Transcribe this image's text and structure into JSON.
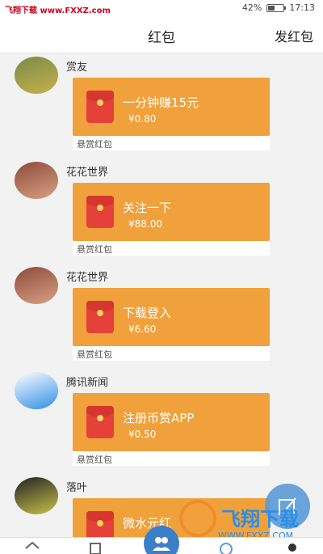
{
  "statusbar": {
    "watermark": "飞翔下载 www.FXXZ.com",
    "battery": "42%",
    "battery_level": 0.42,
    "time": "17:13"
  },
  "header": {
    "title": "红包",
    "action": "发红包"
  },
  "feed": {
    "items": [
      {
        "user": "赏友",
        "title": "一分钟赚15元",
        "amount": "¥0.80",
        "tag": "悬赏红包",
        "avatar_colors": [
          "#7a8b4a",
          "#c7b04a"
        ]
      },
      {
        "user": "花花世界",
        "title": "关注一下",
        "amount": "¥88.00",
        "tag": "悬赏红包",
        "avatar_colors": [
          "#8b4a3a",
          "#d9a184"
        ]
      },
      {
        "user": "花花世界",
        "title": "下载登入",
        "amount": "¥6.60",
        "tag": "悬赏红包",
        "avatar_colors": [
          "#8b4a3a",
          "#d9a184"
        ]
      },
      {
        "user": "腾讯新闻",
        "title": "注册币赏APP",
        "amount": "¥0.50",
        "tag": "悬赏红包",
        "avatar_colors": [
          "#ffffff",
          "#2f8de4"
        ]
      },
      {
        "user": "落叶",
        "title": "微水元红",
        "amount": "",
        "tag": "",
        "avatar_colors": [
          "#222222",
          "#c9c24a"
        ]
      }
    ]
  },
  "bottom_watermark": {
    "brand": "飞翔下载",
    "url": "WWW.FXXZ.COM"
  },
  "colors": {
    "card": "#f0a13b",
    "envelope": "#e6403a",
    "accent": "#3b7fc8"
  }
}
